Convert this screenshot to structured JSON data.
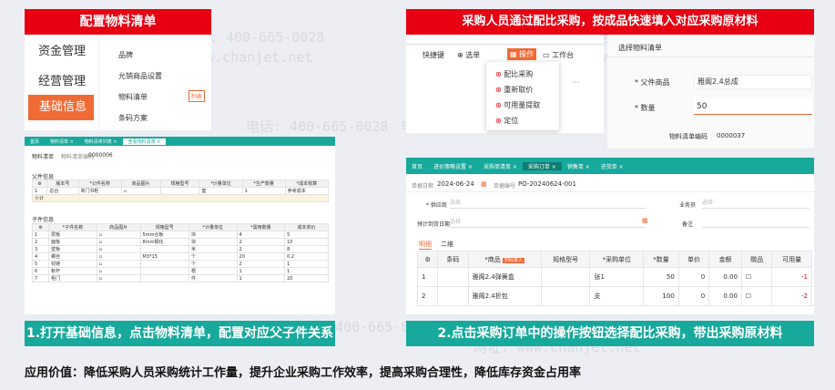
{
  "watermark": {
    "phone": "电话: 400-665-0028",
    "site": "网址: www.chanjet.net"
  },
  "left": {
    "title": "配置物料清单",
    "menu": [
      "资金管理",
      "经营管理",
      "基础信息"
    ],
    "submenu": [
      "品牌",
      "允销商品设置",
      "物料清单",
      "条码方案"
    ],
    "submenu_badge": "列表",
    "tabs": [
      "首页",
      "物料清单 ×",
      "物料清单列表 ×",
      "查看物料清单 ×"
    ],
    "subtabs": [
      "物料清单",
      "物料清单编码",
      "0000006"
    ],
    "parent_section": "父件信息",
    "parent_headers": [
      "",
      "版本号",
      "*父件名称",
      "商品图片",
      "规格型号",
      "*计量单位",
      "*生产数量",
      "*成本核算"
    ],
    "parent_rows": [
      [
        "1",
        "",
        "总台",
        "单门书柜",
        "",
        "",
        "套",
        "1",
        "参考成本"
      ]
    ],
    "subtotal": "小计",
    "child_section": "子件信息",
    "child_headers": [
      "",
      "*子件名称",
      "商品图片",
      "规格型号",
      "*计量单位",
      "*需用数量",
      "成本单价"
    ],
    "child_rows": [
      [
        "1",
        "层板",
        "",
        "5mm合板",
        "块",
        "4",
        "5"
      ],
      [
        "2",
        "面板",
        "",
        "8mm钢化",
        "块",
        "2",
        "10"
      ],
      [
        "3",
        "壁板",
        "",
        "",
        "米",
        "2",
        "8"
      ],
      [
        "4",
        "螺丝",
        "",
        "M3*15",
        "个",
        "20",
        "0.2"
      ],
      [
        "5",
        "铰链",
        "",
        "",
        "个",
        "2",
        "1"
      ],
      [
        "6",
        "帐杆",
        "",
        "",
        "根",
        "1",
        "1"
      ],
      [
        "7",
        "柜门",
        "",
        "",
        "件",
        "1",
        "20"
      ]
    ],
    "caption": "1.打开基础信息，点击物料清单，配置对应父子件关系"
  },
  "right": {
    "title": "采购人员通过配比采购，按成品快速填入对应采购原材料",
    "toolbar": [
      "快捷键",
      "选单",
      "操作",
      "工作台"
    ],
    "dropdown": [
      "配比采购",
      "重新取价",
      "可用量提取",
      "定位"
    ],
    "dialog_title": "选择物料清单",
    "field_parent_label": "* 父件商品",
    "field_parent_value": "雅阁2.4总成",
    "field_qty_label": "* 数量",
    "field_qty_value": "50",
    "field_code_label": "物料清单编码",
    "field_code_value": "0000037",
    "tabs": [
      "首页",
      "进价策略设置 ×",
      "采购单清单 ×",
      "采购订单 ×",
      "销售单 ×",
      "进货单 ×"
    ],
    "order_date_label": "单据日期",
    "order_date": "2024-06-24",
    "order_no_label": "单据编号",
    "order_no": "PO-20240624-001",
    "supplier_label": "* 供应商",
    "supplier_ph": "选择",
    "staff_label": "业务员",
    "staff_ph": "选择",
    "arrive_label": "预计到货日期",
    "arrive_ph": "选择",
    "note_label": "备注",
    "detail_tabs": [
      "明细",
      "二维"
    ],
    "headers": [
      "",
      "条码",
      "*商品",
      "规格型号",
      "*采购单位",
      "*数量",
      "单价",
      "金额",
      "赠品",
      "可用量"
    ],
    "badge": "扫码录入",
    "rows": [
      [
        "1",
        "",
        "雅阁2.4弹簧盒",
        "",
        "张1",
        "50",
        "0",
        "0.00",
        "",
        "-1"
      ],
      [
        "2",
        "",
        "雅阁2.4折包",
        "",
        "支",
        "100",
        "0",
        "0.00",
        "",
        "-2"
      ]
    ],
    "caption": "2.点击采购订单中的操作按钮选择配比采购，带出采购原材料"
  },
  "footer": "应用价值：降低采购人员采购统计工作量，提升企业采购工作效率，提高采购合理性，降低库存资金占用率"
}
